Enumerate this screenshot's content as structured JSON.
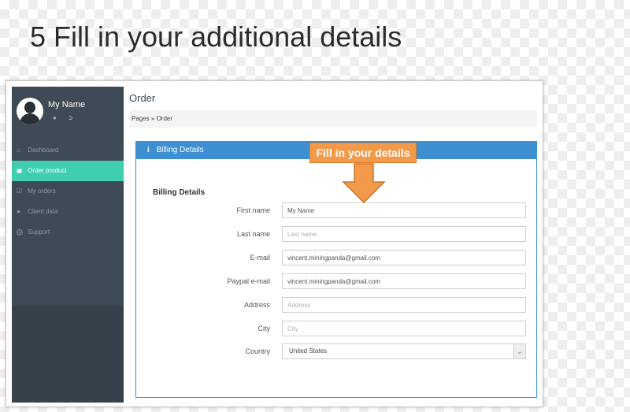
{
  "slide": {
    "title": "5 Fill in your additional details"
  },
  "callout": {
    "text": "Fill in your details",
    "color": "#f39a4a"
  },
  "sidebar": {
    "user_name": "My Name",
    "profile_icons": [
      "user-icon",
      "sign-out-icon"
    ],
    "items": [
      {
        "label": "Dashboard",
        "icon": "home-icon",
        "active": false
      },
      {
        "label": "Order product",
        "icon": "cart-icon",
        "active": true
      },
      {
        "label": "My orders",
        "icon": "checkbox-icon",
        "active": false
      },
      {
        "label": "Client data",
        "icon": "user-icon",
        "active": false
      },
      {
        "label": "Support",
        "icon": "support-icon",
        "active": false
      }
    ],
    "accent": "#3fcfb0"
  },
  "main": {
    "heading": "Order",
    "breadcrumb": "Pages » Order",
    "panel": {
      "header": "Billing Details",
      "header_color": "#3d8fd1",
      "section_title": "Billing Details",
      "fields": {
        "first_name": {
          "label": "First name",
          "value": "My Name",
          "placeholder": ""
        },
        "last_name": {
          "label": "Last name",
          "value": "",
          "placeholder": "Last name"
        },
        "email": {
          "label": "E-mail",
          "value": "vincent.miningpanda@gmail.com",
          "placeholder": ""
        },
        "paypal_email": {
          "label": "Paypal e-mail",
          "value": "vincent.miningpanda@gmail.com",
          "placeholder": ""
        },
        "address": {
          "label": "Address",
          "value": "",
          "placeholder": "Address"
        },
        "city": {
          "label": "City",
          "value": "",
          "placeholder": "City"
        },
        "country": {
          "label": "Country",
          "value": "United States"
        }
      }
    }
  }
}
